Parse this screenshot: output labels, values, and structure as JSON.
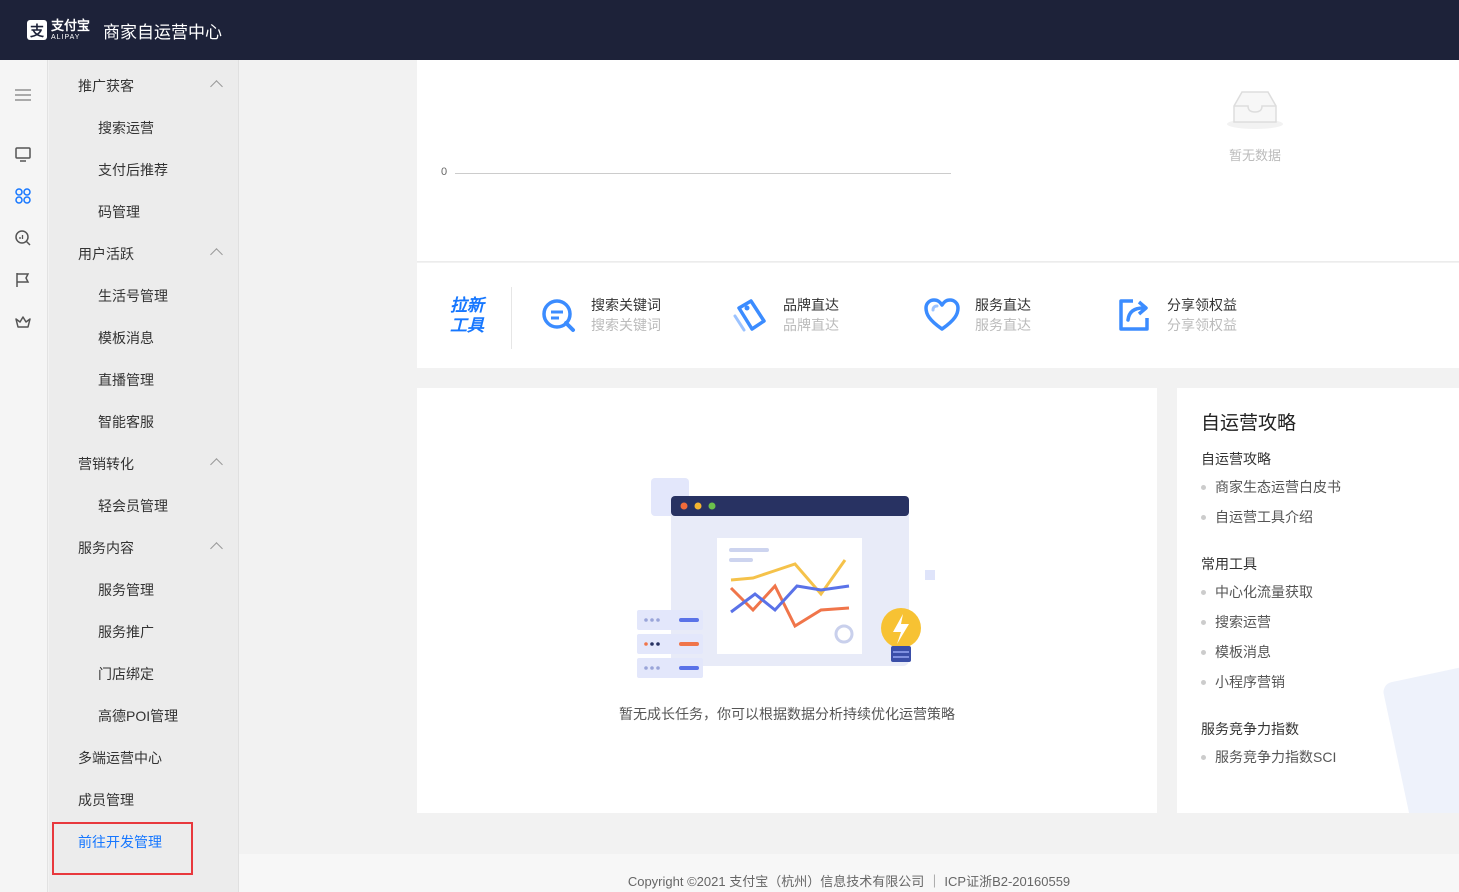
{
  "header": {
    "logo_cn": "支付宝",
    "logo_en": "ALIPAY",
    "title": "商家自运营中心"
  },
  "rail": {
    "icons": [
      "menu-icon",
      "monitor-icon",
      "apps-icon",
      "analytics-icon",
      "flag-icon",
      "crown-icon"
    ]
  },
  "menu": {
    "items": [
      {
        "label": "推广获客",
        "type": "group"
      },
      {
        "label": "搜索运营",
        "type": "sub"
      },
      {
        "label": "支付后推荐",
        "type": "sub"
      },
      {
        "label": "码管理",
        "type": "sub"
      },
      {
        "label": "用户活跃",
        "type": "group"
      },
      {
        "label": "生活号管理",
        "type": "sub"
      },
      {
        "label": "模板消息",
        "type": "sub"
      },
      {
        "label": "直播管理",
        "type": "sub"
      },
      {
        "label": "智能客服",
        "type": "sub"
      },
      {
        "label": "营销转化",
        "type": "group"
      },
      {
        "label": "轻会员管理",
        "type": "sub"
      },
      {
        "label": "服务内容",
        "type": "group"
      },
      {
        "label": "服务管理",
        "type": "sub"
      },
      {
        "label": "服务推广",
        "type": "sub"
      },
      {
        "label": "门店绑定",
        "type": "sub"
      },
      {
        "label": "高德POI管理",
        "type": "sub"
      },
      {
        "label": "多端运营中心",
        "type": "top"
      },
      {
        "label": "成员管理",
        "type": "top"
      },
      {
        "label": "前往开发管理",
        "type": "top"
      }
    ]
  },
  "chart_panel": {
    "axis_zero": "0",
    "empty_text": "暂无数据"
  },
  "tools": {
    "badge_line1": "拉新",
    "badge_line2": "工具",
    "items": [
      {
        "name": "搜索关键词",
        "sub": "搜索关键词",
        "icon": "search-keyword-icon"
      },
      {
        "name": "品牌直达",
        "sub": "品牌直达",
        "icon": "tag-icon"
      },
      {
        "name": "服务直达",
        "sub": "服务直达",
        "icon": "heart-icon"
      },
      {
        "name": "分享领权益",
        "sub": "分享领权益",
        "icon": "share-icon"
      }
    ]
  },
  "tasks": {
    "empty_text": "暂无成长任务，你可以根据数据分析持续优化运营策略"
  },
  "guide": {
    "title": "自运营攻略",
    "sections": [
      {
        "title": "自运营攻略",
        "links": [
          "商家生态运营白皮书",
          "自运营工具介绍"
        ]
      },
      {
        "title": "常用工具",
        "links": [
          "中心化流量获取",
          "搜索运营",
          "模板消息",
          "小程序营销"
        ]
      },
      {
        "title": "服务竞争力指数",
        "links": [
          "服务竞争力指数SCI"
        ]
      }
    ]
  },
  "footer": {
    "text": "Copyright ©2021 支付宝（杭州）信息技术有限公司 ｜ ICP证浙B2-20160559"
  },
  "colors": {
    "header_bg": "#1d2239",
    "accent": "#1677ff",
    "highlight": "#e8383d"
  }
}
